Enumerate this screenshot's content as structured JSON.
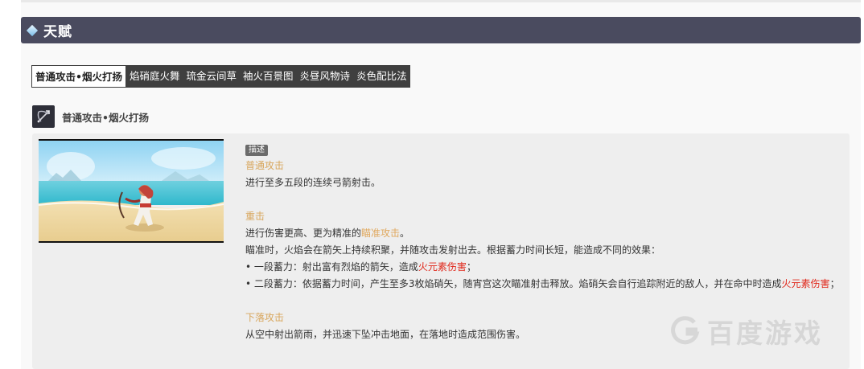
{
  "section": {
    "title": "天赋"
  },
  "tabs": [
    {
      "label": "普通攻击•烟火打扬",
      "active": true
    },
    {
      "label": "焰硝庭火舞",
      "active": false
    },
    {
      "label": "琉金云间草",
      "active": false
    },
    {
      "label": "袖火百景图",
      "active": false
    },
    {
      "label": "炎昼风物诗",
      "active": false
    },
    {
      "label": "炎色配比法",
      "active": false
    }
  ],
  "skill": {
    "name": "普通攻击•烟火打扬",
    "icon": "bow-attack-icon"
  },
  "description": {
    "badge": "描述",
    "normal": {
      "heading": "普通攻击",
      "text": "进行至多五段的连续弓箭射击。"
    },
    "charged": {
      "heading": "重击",
      "line1_pre": "进行伤害更高、更为精准的",
      "line1_hl": "瞄准攻击",
      "line1_post": "。",
      "line2": "瞄准时，火焰会在箭矢上持续积聚，并随攻击发射出去。根据蓄力时间长短，能造成不同的效果：",
      "line3_pre": "• 一段蓄力：射出富有烈焰的箭矢，造成",
      "line3_hl": "火元素伤害",
      "line3_post": "；",
      "line4_pre": "• 二段蓄力：依据蓄力时间，产生至多3枚焰硝矢，随宵宫这次瞄准射击释放。焰硝矢会自行追踪附近的敌人，并在命中时造成",
      "line4_hl": "火元素伤害",
      "line4_post": "；"
    },
    "plunge": {
      "heading": "下落攻击",
      "text": "从空中射出箭雨，并迅速下坠冲击地面，在落地时造成范围伤害。"
    }
  },
  "watermark": {
    "text": "百度游戏",
    "icon": "baidu-game-logo-icon"
  },
  "colors": {
    "header_bg": "#4a4b5f",
    "tab_bg": "#3f3f3f",
    "accent_orange": "#d8a65c",
    "accent_red": "#e0271a"
  }
}
